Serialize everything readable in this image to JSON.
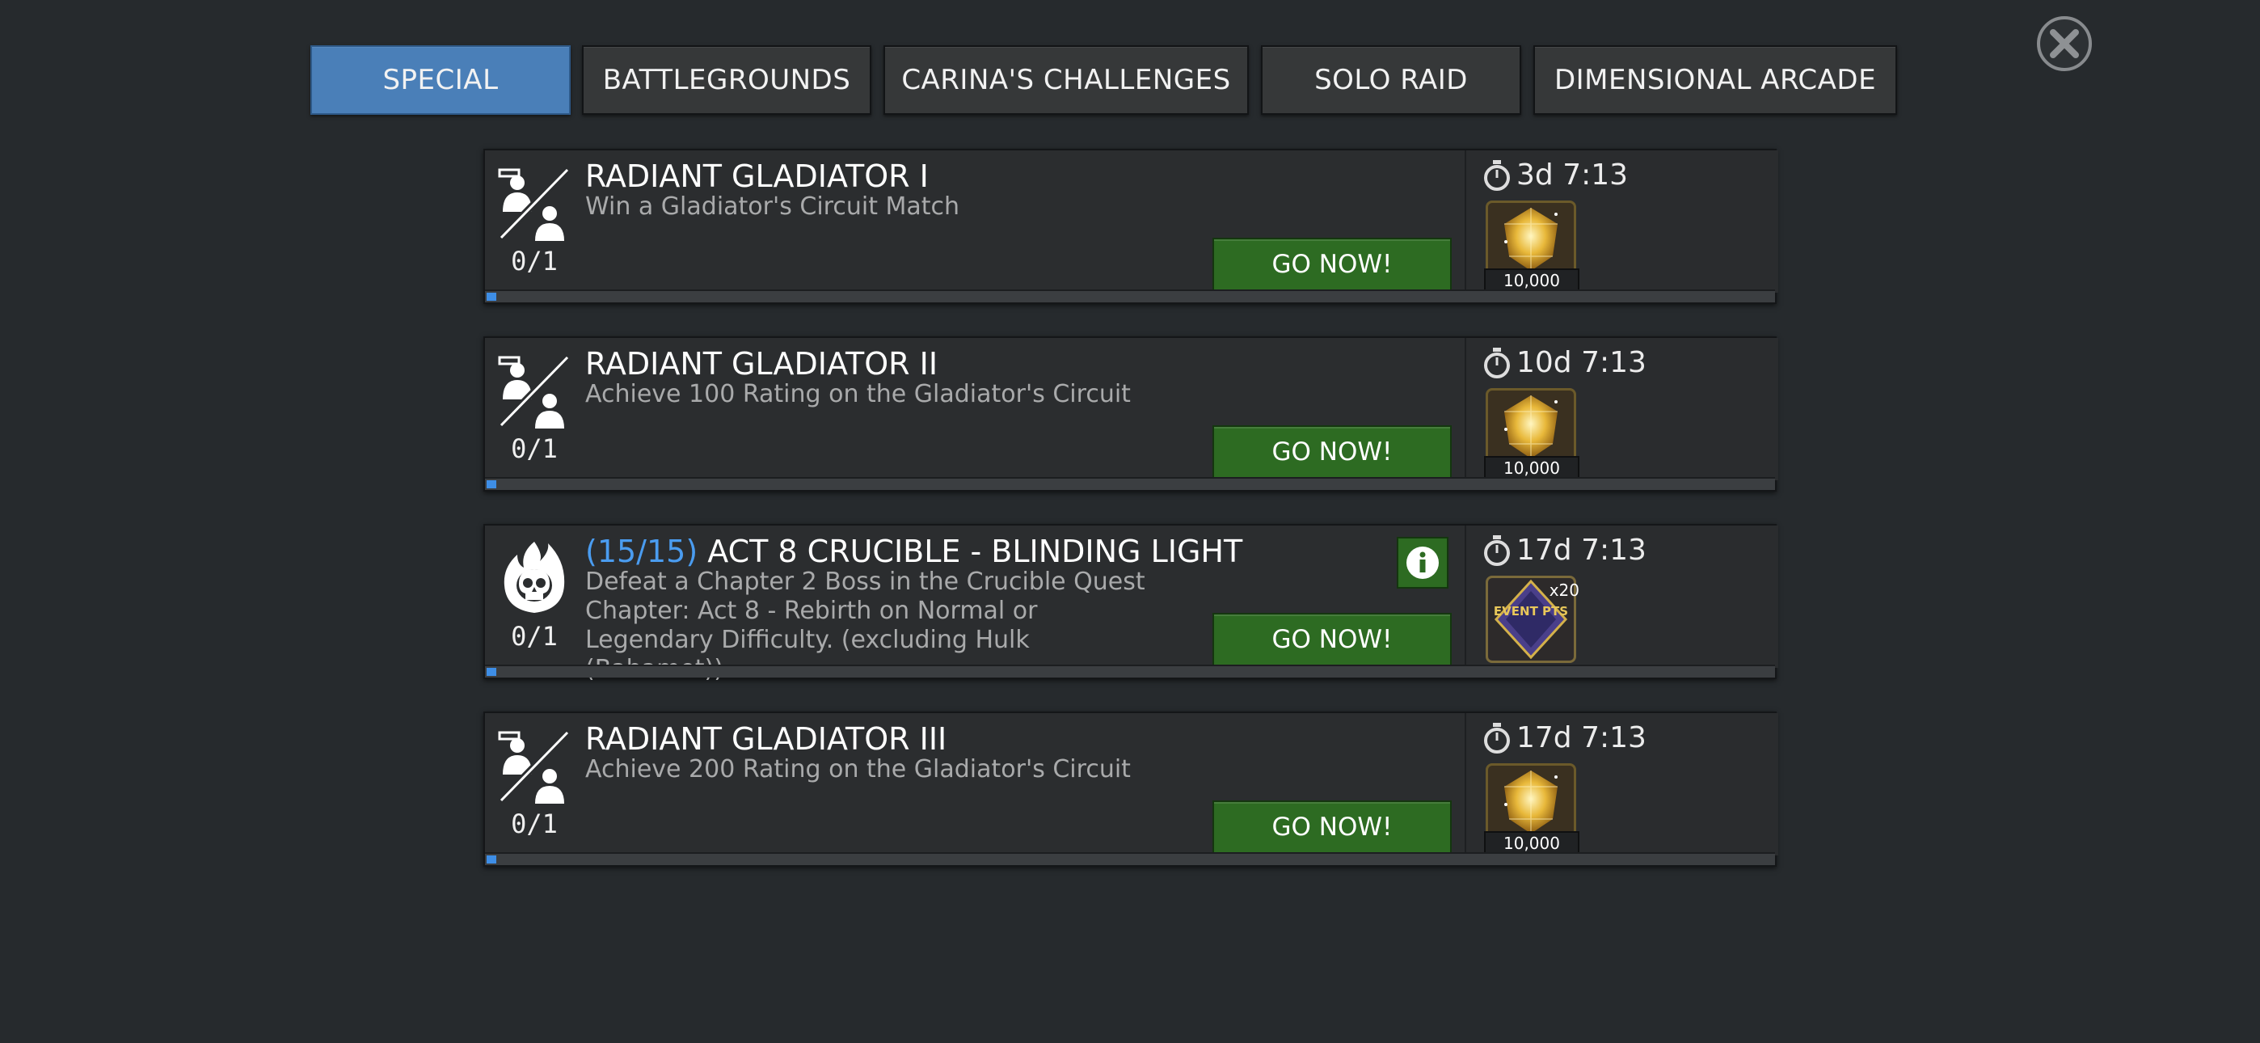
{
  "tabs": [
    {
      "label": "SPECIAL",
      "active": true
    },
    {
      "label": "BATTLEGROUNDS",
      "active": false
    },
    {
      "label": "CARINA'S CHALLENGES",
      "active": false
    },
    {
      "label": "SOLO RAID",
      "active": false
    },
    {
      "label": "DIMENSIONAL ARCADE",
      "active": false
    }
  ],
  "quests": [
    {
      "icon": "gladiator-icon",
      "title": "RADIANT GLADIATOR I",
      "title_prefix": "",
      "description": "Win a Gladiator's Circuit Match",
      "progress_text": "0/1",
      "progress": 0,
      "button_label": "GO NOW!",
      "timer": "3d 7:13",
      "reward_icon": "gold-crystal-icon",
      "reward_amount": "10,000",
      "has_info": false
    },
    {
      "icon": "gladiator-icon",
      "title": "RADIANT GLADIATOR II",
      "title_prefix": "",
      "description": "Achieve 100 Rating on the Gladiator's Circuit",
      "progress_text": "0/1",
      "progress": 0,
      "button_label": "GO NOW!",
      "timer": "10d 7:13",
      "reward_icon": "gold-crystal-icon",
      "reward_amount": "10,000",
      "has_info": false
    },
    {
      "icon": "flaming-skull-icon",
      "title": "ACT 8 CRUCIBLE - BLINDING LIGHT",
      "title_prefix": "(15/15)",
      "description": "Defeat a Chapter 2 Boss in the Crucible Quest Chapter: Act 8 - Rebirth on Normal or Legendary Difficulty. (excluding Hulk (Bahamet))",
      "progress_text": "0/1",
      "progress": 0,
      "button_label": "GO NOW!",
      "timer": "17d 7:13",
      "reward_icon": "event-pts-icon",
      "reward_text": "EVENT PTS",
      "reward_multiplier": "x20",
      "has_info": true
    },
    {
      "icon": "gladiator-icon",
      "title": "RADIANT GLADIATOR III",
      "title_prefix": "",
      "description": "Achieve 200 Rating on the Gladiator's Circuit",
      "progress_text": "0/1",
      "progress": 0,
      "button_label": "GO NOW!",
      "timer": "17d 7:13",
      "reward_icon": "gold-crystal-icon",
      "reward_amount": "10,000",
      "has_info": false
    }
  ],
  "colors": {
    "background": "#262a2d",
    "tab_active": "#4a7fb8",
    "go_button": "#2d6b22",
    "progress": "#3e8ee6",
    "title_prefix": "#4a9cf0"
  }
}
